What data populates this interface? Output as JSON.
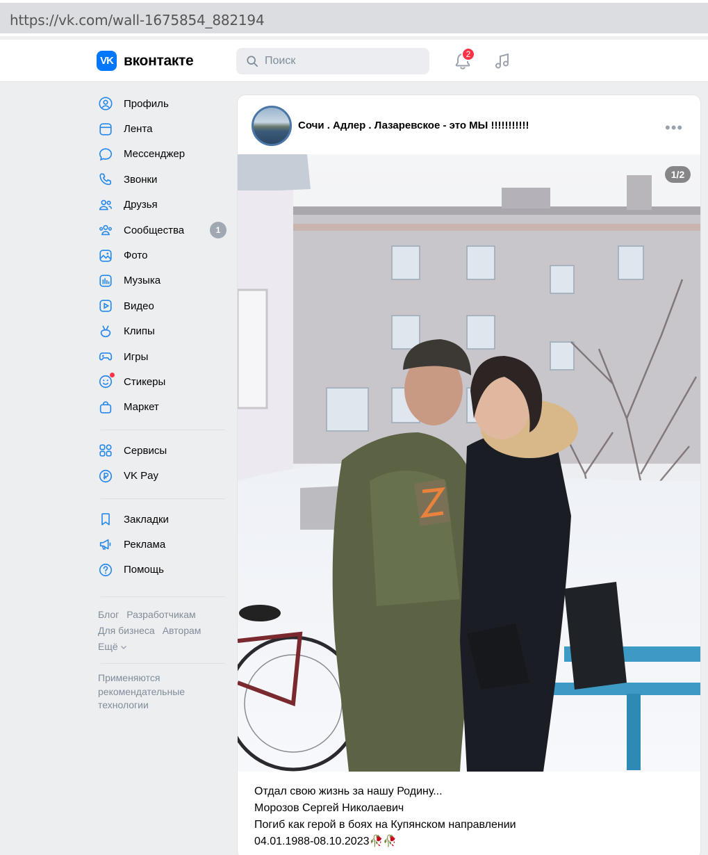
{
  "browser": {
    "url": "https://vk.com/wall-1675854_882194"
  },
  "header": {
    "logo_text": "вконтакте",
    "search_placeholder": "Поиск",
    "notifications_count": "2"
  },
  "sidebar": {
    "items": [
      {
        "label": "Профиль",
        "icon": "profile-icon"
      },
      {
        "label": "Лента",
        "icon": "feed-icon"
      },
      {
        "label": "Мессенджер",
        "icon": "messenger-icon"
      },
      {
        "label": "Звонки",
        "icon": "phone-icon"
      },
      {
        "label": "Друзья",
        "icon": "friends-icon"
      },
      {
        "label": "Сообщества",
        "icon": "communities-icon",
        "count": "1"
      },
      {
        "label": "Фото",
        "icon": "photo-icon"
      },
      {
        "label": "Музыка",
        "icon": "music-icon"
      },
      {
        "label": "Видео",
        "icon": "video-icon"
      },
      {
        "label": "Клипы",
        "icon": "clips-icon"
      },
      {
        "label": "Игры",
        "icon": "games-icon"
      },
      {
        "label": "Стикеры",
        "icon": "stickers-icon"
      },
      {
        "label": "Маркет",
        "icon": "market-icon"
      }
    ],
    "services": [
      {
        "label": "Сервисы",
        "icon": "services-icon"
      },
      {
        "label": "VK Pay",
        "icon": "vkpay-icon"
      }
    ],
    "extra": [
      {
        "label": "Закладки",
        "icon": "bookmark-icon"
      },
      {
        "label": "Реклама",
        "icon": "ads-icon"
      },
      {
        "label": "Помощь",
        "icon": "help-icon"
      }
    ],
    "footer_links": [
      "Блог",
      "Разработчикам",
      "Для бизнеса",
      "Авторам",
      "Ещё"
    ],
    "footer_note": [
      "Применяются",
      "рекомендательные",
      "технологии"
    ]
  },
  "post": {
    "author": "Сочи . Адлер . Лазаревское - это МЫ !!!!!!!!!!!",
    "photo_counter": "1/2",
    "text_lines": [
      "Отдал свою жизнь за нашу Родину...",
      "Морозов Сергей Николаевич",
      "Погиб как герой в боях на Купянском направлении",
      "04.01.1988-08.10.2023🥀🥀"
    ]
  },
  "colors": {
    "accent": "#0077ff",
    "badge": "#ff3347",
    "icon": "#2688eb"
  }
}
